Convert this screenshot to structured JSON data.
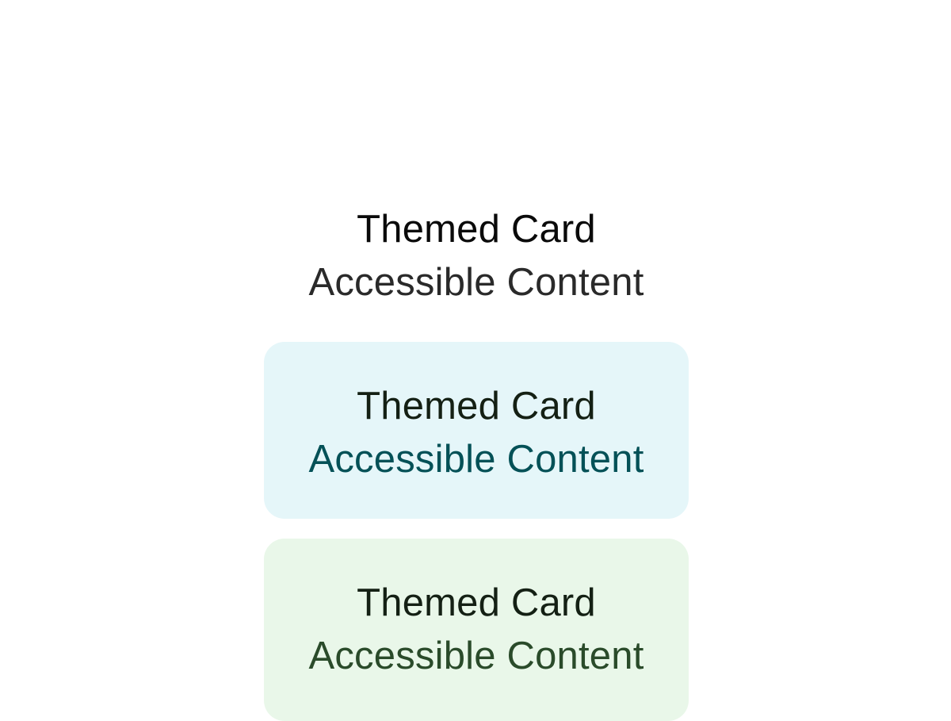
{
  "cards": [
    {
      "theme": "default",
      "title": "Themed Card",
      "content": "Accessible Content",
      "background": "#ffffff",
      "title_color": "#0a0a0a",
      "content_color": "#2a2a2a"
    },
    {
      "theme": "cyan",
      "title": "Themed Card",
      "content": "Accessible Content",
      "background": "#e5f6f9",
      "title_color": "#142014",
      "content_color": "#045157"
    },
    {
      "theme": "green",
      "title": "Themed Card",
      "content": "Accessible Content",
      "background": "#e9f7e9",
      "title_color": "#142014",
      "content_color": "#2a4b2a"
    }
  ]
}
